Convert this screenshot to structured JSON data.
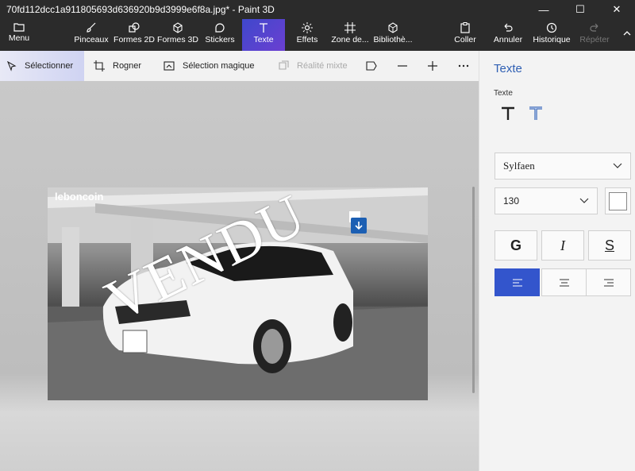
{
  "window": {
    "title": "70fd112dcc1a911805693d636920b9d3999e6f8a.jpg* - Paint 3D",
    "minimize": "—",
    "maximize": "☐",
    "close": "✕"
  },
  "ribbon": {
    "menu": "Menu",
    "tools": [
      {
        "label": "Pinceaux",
        "icon": "brush-icon"
      },
      {
        "label": "Formes 2D",
        "icon": "shapes-2d-icon"
      },
      {
        "label": "Formes 3D",
        "icon": "cube-icon"
      },
      {
        "label": "Stickers",
        "icon": "sticker-icon"
      },
      {
        "label": "Texte",
        "icon": "text-icon",
        "active": true
      },
      {
        "label": "Effets",
        "icon": "sun-icon"
      },
      {
        "label": "Zone de...",
        "icon": "canvas-icon"
      },
      {
        "label": "Bibliothè...",
        "icon": "library-icon"
      }
    ],
    "paste": "Coller",
    "undo": "Annuler",
    "history": "Historique",
    "redo": "Répéter"
  },
  "toolbar": {
    "select": "Sélectionner",
    "crop": "Rogner",
    "magic_select": "Sélection magique",
    "mixed_reality": "Réalité mixte"
  },
  "canvas": {
    "photo_logo": "leboncoin",
    "overlay_text": "VENDU"
  },
  "panel": {
    "title": "Texte",
    "label": "Texte",
    "font": "Sylfaen",
    "size": "130",
    "text_color": "#ffffff",
    "bold": "G",
    "italic": "I",
    "underline": "S",
    "alignment_selected": "left"
  },
  "colors": {
    "accent": "#3f48cc",
    "panel_title": "#2f5fb3",
    "ribbon_bg": "#2b2b2b"
  }
}
